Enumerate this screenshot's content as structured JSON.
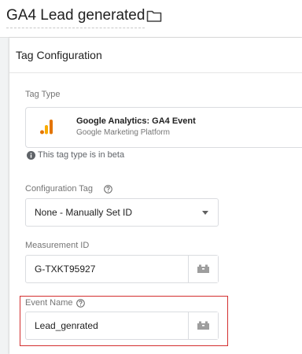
{
  "header": {
    "title": "GA4 Lead generated"
  },
  "panel": {
    "title": "Tag Configuration"
  },
  "tag_type": {
    "label": "Tag Type",
    "name": "Google Analytics: GA4 Event",
    "platform": "Google Marketing Platform",
    "beta_note": "This tag type is in beta"
  },
  "config_tag": {
    "label": "Configuration Tag",
    "selected": "None - Manually Set ID"
  },
  "measurement": {
    "label": "Measurement ID",
    "value": "G-TXKT95927"
  },
  "event": {
    "label": "Event Name",
    "value": "Lead_genrated"
  },
  "colors": {
    "highlight": "#d32f2f",
    "bar_orange": "#f9ab00",
    "bar_dark": "#e37400"
  }
}
